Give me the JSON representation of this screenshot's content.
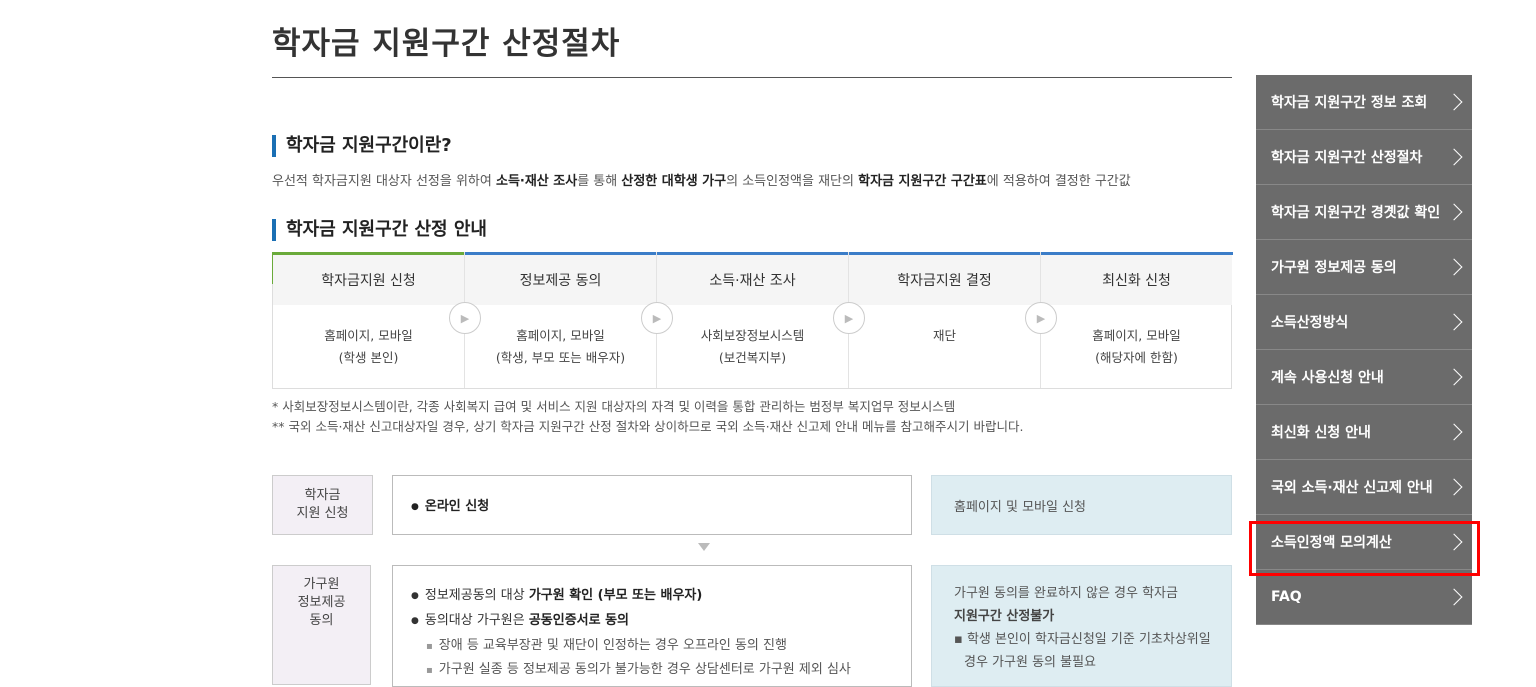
{
  "page": {
    "title": "학자금 지원구간 산정절차"
  },
  "section1": {
    "heading": "학자금 지원구간이란?",
    "desc_parts": [
      "우선적 학자금지원 대상자 선정을 위하여 ",
      "소득·재산 조사",
      "를 통해 ",
      "산정한 대학생 가구",
      "의 소득인정액을 재단의 ",
      "학자금 지원구간 구간표",
      "에 적용하여 결정한 구간값"
    ]
  },
  "section2": {
    "heading": "학자금 지원구간 산정 안내"
  },
  "steps": [
    {
      "title": "학자금지원 신청",
      "line1": "홈페이지, 모바일",
      "line2": "(학생 본인)"
    },
    {
      "title": "정보제공 동의",
      "line1": "홈페이지, 모바일",
      "line2": "(학생, 부모 또는 배우자)"
    },
    {
      "title": "소득·재산 조사",
      "line1": "사회보장정보시스템",
      "line2": "(보건복지부)"
    },
    {
      "title": "학자금지원 결정",
      "line1": "재단",
      "line2": ""
    },
    {
      "title": "최신화 신청",
      "line1": "홈페이지, 모바일",
      "line2": "(해당자에 한함)"
    }
  ],
  "notes": {
    "note1": "* 사회보장정보시스템이란, 각종 사회복지 급여 및 서비스 지원 대상자의 자격 및 이력을 통합 관리하는 범정부 복지업무 정보시스템",
    "note2": "** 국외 소득·재산 신고대상자일 경우, 상기 학자금 지원구간 산정 절차와 상이하므로 국외 소득·재산 신고제 안내 메뉴를 참고해주시기 바랍니다."
  },
  "row1": {
    "label_l1": "학자금",
    "label_l2": "지원 신청",
    "main": "온라인 신청",
    "side": "홈페이지 및 모바일 신청"
  },
  "row2": {
    "label_l1": "가구원",
    "label_l2": "정보제공",
    "label_l3": "동의",
    "b1_pre": "정보제공동의 대상 ",
    "b1_bold": "가구원 확인 (부모 또는 배우자)",
    "b2_pre": "동의대상 가구원은 ",
    "b2_bold": "공동인증서로 동의",
    "s1": "장애 등 교육부장관 및 재단이 인정하는 경우 오프라인 동의 진행",
    "s2": "가구원 실종 등 정보제공 동의가 불가능한 경우 상담센터로 가구원 제외 심사",
    "side_l1": "가구원 동의를 완료하지 않은 경우 학자금",
    "side_l2": "지원구간 산정불가",
    "side_l3": "▪ 학생 본인이 학자금신청일 기준 기초차상위일",
    "side_l4": "경우 가구원 동의 불필요"
  },
  "nav": {
    "items": [
      "학자금 지원구간 정보 조회",
      "학자금 지원구간 산정절차",
      "학자금 지원구간 경곗값 확인",
      "가구원 정보제공 동의",
      "소득산정방식",
      "계속 사용신청 안내",
      "최신화 신청 안내",
      "국외 소득·재산 신고제 안내",
      "소득인정액 모의계산",
      "FAQ"
    ]
  },
  "colors": {
    "accent_blue": "#1a6fb4",
    "step_green": "#6aaa3a",
    "step_blue": "#3b7dc8",
    "nav_bg": "#6b6b6b",
    "highlight": "#ff0000"
  }
}
